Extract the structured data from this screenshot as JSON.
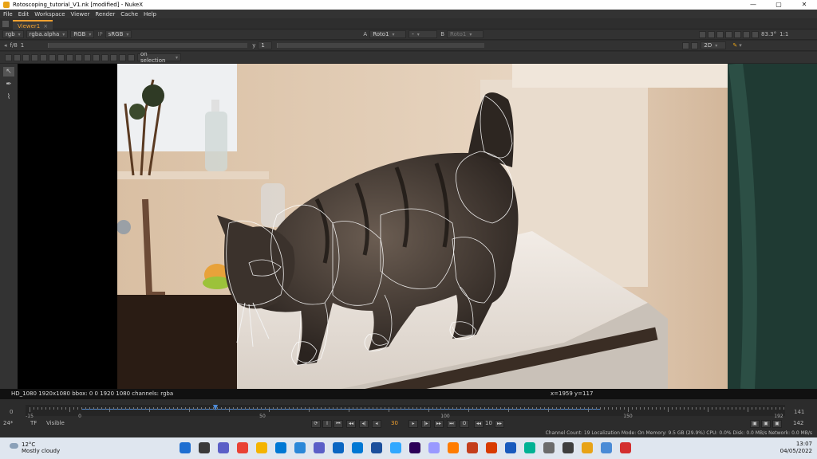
{
  "window": {
    "title": "Rotoscoping_tutorial_V1.nk [modified] - NukeX",
    "minimize_glyph": "—",
    "maximize_glyph": "▢",
    "close_glyph": "✕"
  },
  "menu": [
    "File",
    "Edit",
    "Workspace",
    "Viewer",
    "Render",
    "Cache",
    "Help"
  ],
  "tab": {
    "label": "Viewer1",
    "close": "×"
  },
  "viewer_toolbar": {
    "layer": "rgb",
    "channel": "rgba.alpha",
    "display": "RGB",
    "ip_label": "IP",
    "lut": "sRGB",
    "input_a_label": "A",
    "input_a": "Roto1",
    "wipe": "-",
    "input_b_label": "B",
    "input_b": "Roto1",
    "zoom_pct": "83.3°",
    "proxy": "1:1"
  },
  "gain_toolbar": {
    "fstop_label": "f/8",
    "fstop_value": "1",
    "gamma_label": "y",
    "gamma_value": "1",
    "view_mode": "2D"
  },
  "roto_toolbar": {
    "selection_mode": "on selection"
  },
  "info_bar": {
    "format": "HD_1080 1920x1080  bbox: 0 0 1920 1080 channels: rgba",
    "coords": "x=1959 y=117"
  },
  "timeline": {
    "start": "0",
    "end": "141",
    "tick_labels": [
      "-15",
      "0",
      "50",
      "100",
      "150",
      "192"
    ],
    "fps": "24*",
    "tf": "TF",
    "visibility": "Visible",
    "current_frame": "30",
    "increment": "10",
    "end_frame": "142"
  },
  "status_bar": {
    "text": "Channel Count: 19  Localization Mode: On  Memory: 9.5 GB (29.9%)  CPU: 0.0%  Disk: 0.0 MB/s  Network: 0.0 MB/s"
  },
  "taskbar": {
    "temperature": "12°C",
    "weather": "Mostly cloudy",
    "time": "13:07",
    "date": "04/05/2022",
    "icon_colors": [
      "#1f6fd1",
      "#3a3a3a",
      "#5b5fc7",
      "#e94235",
      "#f4b400",
      "#0078d4",
      "#2b88d8",
      "#5b5fc7",
      "#0a66c2",
      "#0078d4",
      "#1b4f9c",
      "#31a8ff",
      "#2b0057",
      "#9999ff",
      "#ff7c00",
      "#c43e1c",
      "#d83b01",
      "#185abd",
      "#00b294",
      "#6b6b6b",
      "#3e3e3e",
      "#e8a317",
      "#4a8bd6",
      "#d32f2f"
    ]
  }
}
